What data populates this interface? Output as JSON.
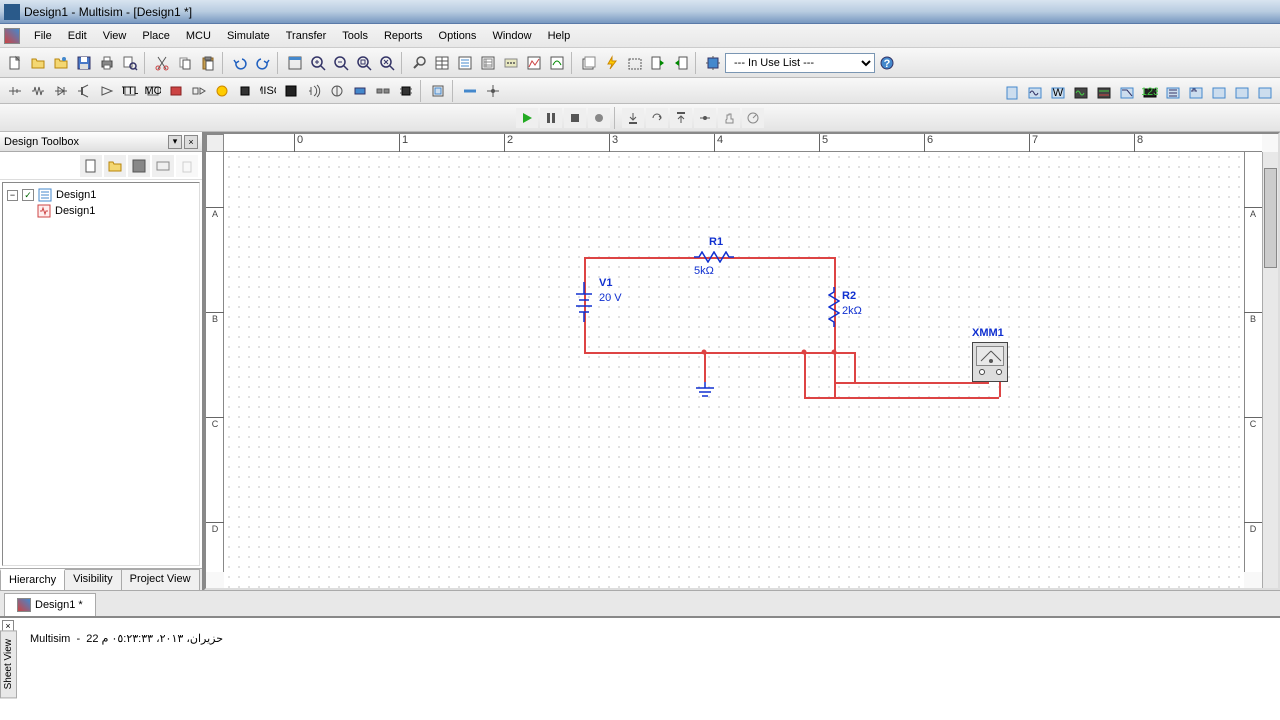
{
  "window": {
    "title": "Design1 - Multisim - [Design1 *]"
  },
  "menu": {
    "file": "File",
    "edit": "Edit",
    "view": "View",
    "place": "Place",
    "mcu": "MCU",
    "simulate": "Simulate",
    "transfer": "Transfer",
    "tools": "Tools",
    "reports": "Reports",
    "options": "Options",
    "window": "Window",
    "help": "Help"
  },
  "toolbar": {
    "in_use_list": "--- In Use List ---"
  },
  "design_toolbox": {
    "title": "Design Toolbox",
    "root": "Design1",
    "child": "Design1",
    "tabs": {
      "hierarchy": "Hierarchy",
      "visibility": "Visibility",
      "project": "Project View"
    }
  },
  "ruler": {
    "h": [
      "0",
      "1",
      "2",
      "3",
      "4",
      "5",
      "6",
      "7",
      "8"
    ],
    "v": [
      "A",
      "B",
      "C",
      "D"
    ]
  },
  "circuit": {
    "v1": {
      "name": "V1",
      "value": "20 V"
    },
    "r1": {
      "name": "R1",
      "value": "5kΩ"
    },
    "r2": {
      "name": "R2",
      "value": "2kΩ"
    },
    "xmm1": {
      "name": "XMM1"
    }
  },
  "doc_tab": "Design1 *",
  "output": {
    "app": "Multisim",
    "sep": "-",
    "timestamp": "حزيران، ٢٠١٣، ٠٥:٢٣:٣٣ م 22"
  },
  "side_tab": "Sheet View"
}
